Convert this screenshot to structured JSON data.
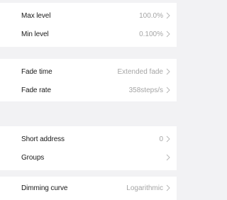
{
  "sections": [
    {
      "rows": [
        {
          "label": "Max level",
          "value": "100.0%"
        },
        {
          "label": "Min level",
          "value": "0.100%"
        }
      ]
    },
    {
      "rows": [
        {
          "label": "Fade time",
          "value": "Extended fade"
        },
        {
          "label": "Fade rate",
          "value": "358steps/s"
        }
      ]
    },
    {
      "rows": [
        {
          "label": "Short address",
          "value": "0"
        },
        {
          "label": "Groups",
          "value": ""
        }
      ]
    },
    {
      "rows": [
        {
          "label": "Dimming curve",
          "value": "Logarithmic"
        }
      ]
    }
  ],
  "icons": {
    "row_chevron": "chevron-right-icon"
  },
  "colors": {
    "background": "#f2f2f4",
    "card": "#ffffff",
    "value_text": "#a5a5a5",
    "label_text": "#1a1a1a"
  }
}
